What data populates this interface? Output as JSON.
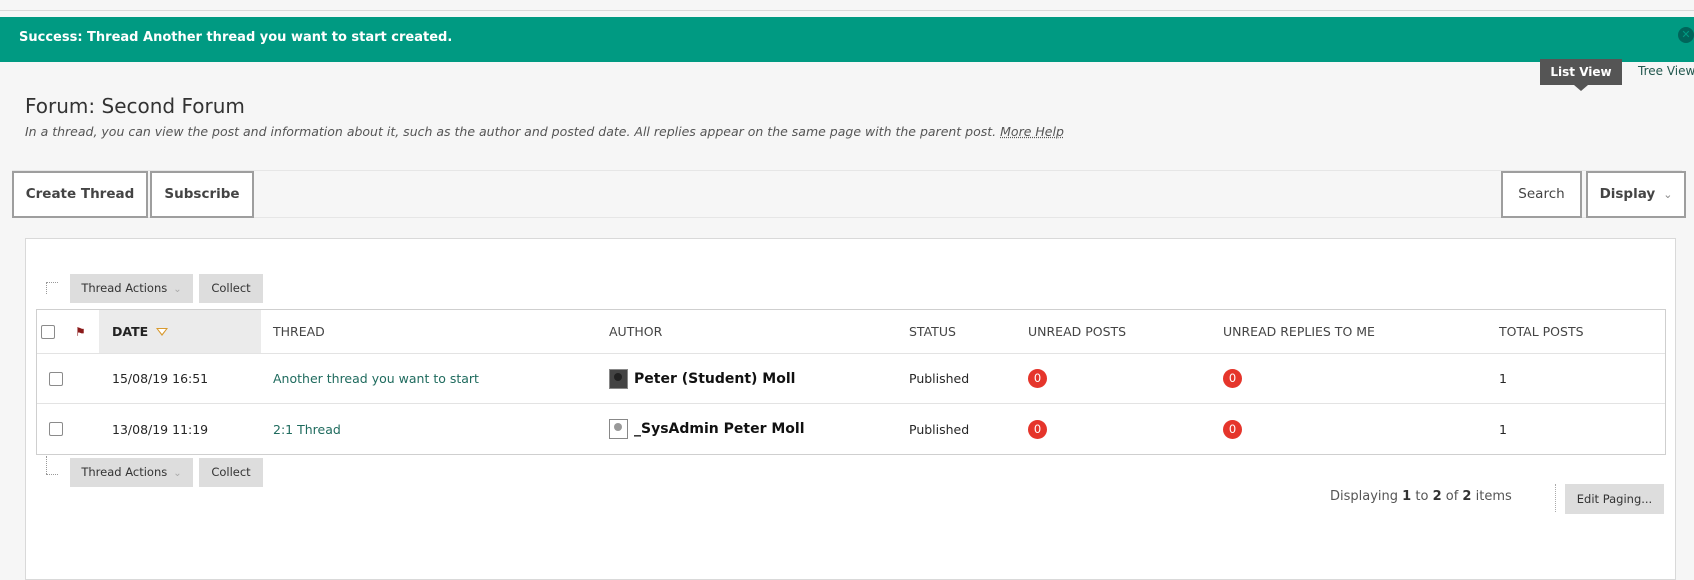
{
  "notification": {
    "message": "Success: Thread Another thread you want to start created.",
    "close_icon": "close-icon"
  },
  "view_toggle": {
    "list_view": "List View",
    "tree_view": "Tree View"
  },
  "forum": {
    "title": "Forum: Second Forum",
    "description": "In a thread, you can view the post and information about it, such as the author and posted date. All replies appear on the same page with the parent post.",
    "more_help": "More Help"
  },
  "actionbar": {
    "create_thread": "Create Thread",
    "subscribe": "Subscribe",
    "search": "Search",
    "display": "Display"
  },
  "table_actions": {
    "thread_actions": "Thread Actions",
    "collect": "Collect"
  },
  "table": {
    "headers": {
      "date": "DATE",
      "thread": "THREAD",
      "author": "AUTHOR",
      "status": "STATUS",
      "unread_posts": "UNREAD POSTS",
      "unread_replies": "UNREAD REPLIES TO ME",
      "total_posts": "TOTAL POSTS"
    },
    "rows": [
      {
        "date": "15/08/19 16:51",
        "thread": "Another thread you want to start",
        "author": "Peter (Student) Moll",
        "status": "Published",
        "unread_posts": "0",
        "unread_replies": "0",
        "total_posts": "1"
      },
      {
        "date": "13/08/19 11:19",
        "thread": "2:1 Thread",
        "author": "_SysAdmin Peter Moll",
        "status": "Published",
        "unread_posts": "0",
        "unread_replies": "0",
        "total_posts": "1"
      }
    ]
  },
  "paging": {
    "prefix": "Displaying",
    "from": "1",
    "to_word": "to",
    "to": "2",
    "of_word": "of",
    "total": "2",
    "suffix": "items",
    "edit_paging": "Edit Paging..."
  },
  "colors": {
    "success_bg": "#009a82",
    "link": "#1f6b5e",
    "badge": "#e5352b",
    "sort_indicator": "#d89a2f"
  }
}
